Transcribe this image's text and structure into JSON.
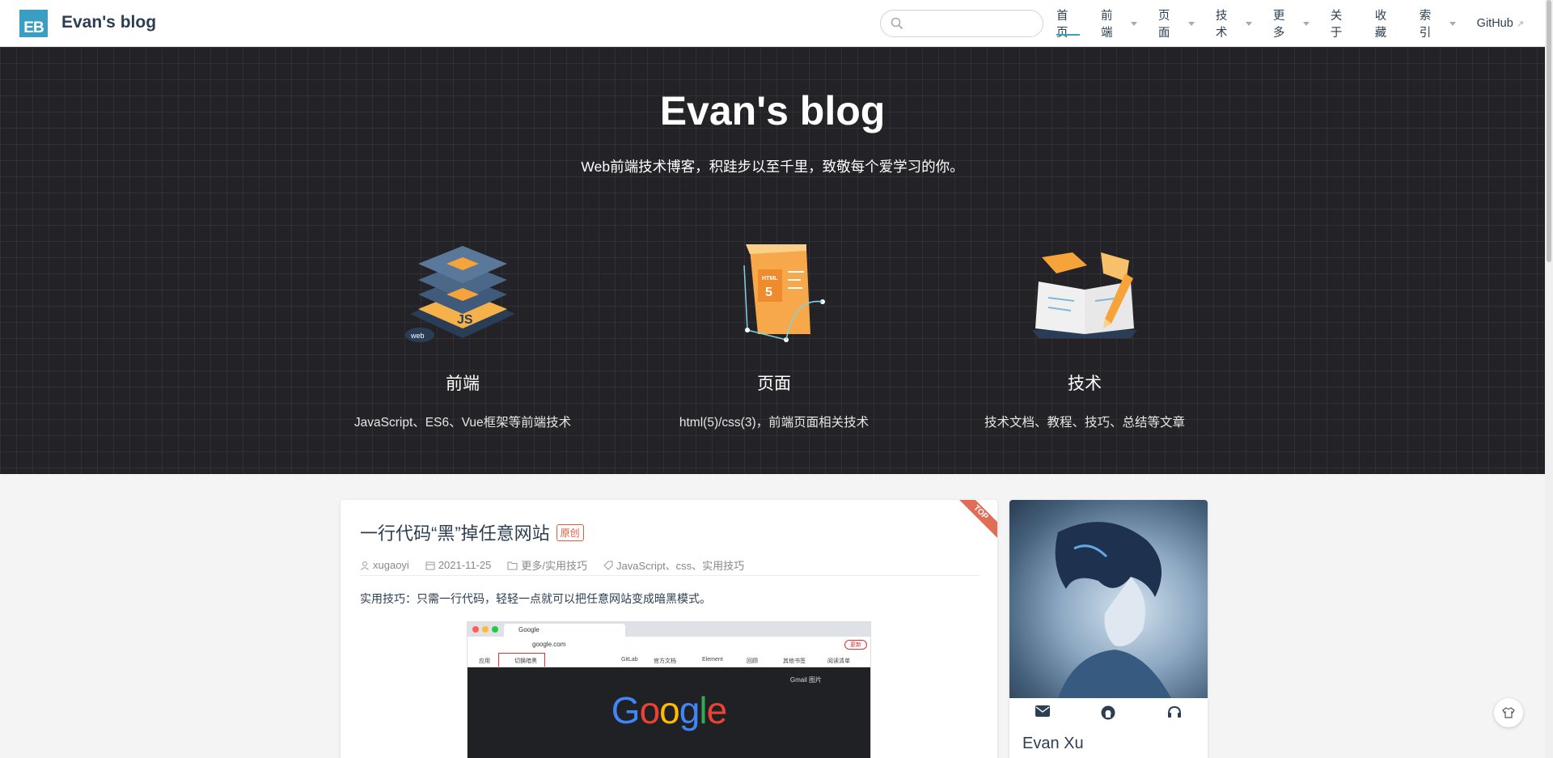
{
  "header": {
    "logo_text": "EB",
    "site_name": "Evan's blog",
    "search": {
      "placeholder": "",
      "value": ""
    },
    "nav": [
      {
        "label": "首页",
        "active": true,
        "dropdown": false
      },
      {
        "label": "前端",
        "dropdown": true
      },
      {
        "label": "页面",
        "dropdown": true
      },
      {
        "label": "技术",
        "dropdown": true
      },
      {
        "label": "更多",
        "dropdown": true
      },
      {
        "label": "关于",
        "dropdown": false
      },
      {
        "label": "收藏",
        "dropdown": false
      },
      {
        "label": "索引",
        "dropdown": true
      },
      {
        "label": "GitHub",
        "external": true
      }
    ]
  },
  "hero": {
    "title": "Evan's blog",
    "description": "Web前端技术博客，积跬步以至千里，致敬每个爱学习的你。",
    "features": [
      {
        "title": "前端",
        "desc": "JavaScript、ES6、Vue框架等前端技术",
        "icon": "js-layers-illustration"
      },
      {
        "title": "页面",
        "desc": "html(5)/css(3)，前端页面相关技术",
        "icon": "html5-board-illustration"
      },
      {
        "title": "技术",
        "desc": "技术文档、教程、技巧、总结等文章",
        "icon": "open-book-illustration"
      }
    ]
  },
  "post": {
    "top_label": "TOP",
    "title": "一行代码“黑”掉任意网站",
    "badge": "原创",
    "author": "xugaoyi",
    "date": "2021-11-25",
    "category": "更多/实用技巧",
    "tags": "JavaScript、css、实用技巧",
    "summary": "实用技巧：只需一行代码，轻轻一点就可以把任意网站变成暗黑模式。",
    "screenshot": {
      "tab": "Google",
      "url": "google.com",
      "update_label": "更新",
      "bookmarks": [
        "应用",
        "切换暗黑",
        "GitLab",
        "官方文档",
        "Element",
        "回顾",
        "其他书签",
        "阅读清单"
      ],
      "gmail": "Gmail",
      "images": "图片",
      "logo": "Google"
    }
  },
  "profile": {
    "name": "Evan Xu",
    "icons": [
      "mail-icon",
      "github-icon",
      "headphones-icon"
    ]
  },
  "colors": {
    "accent": "#3a9ec2",
    "hero_bg": "#232226",
    "badge": "#e35a3d"
  }
}
